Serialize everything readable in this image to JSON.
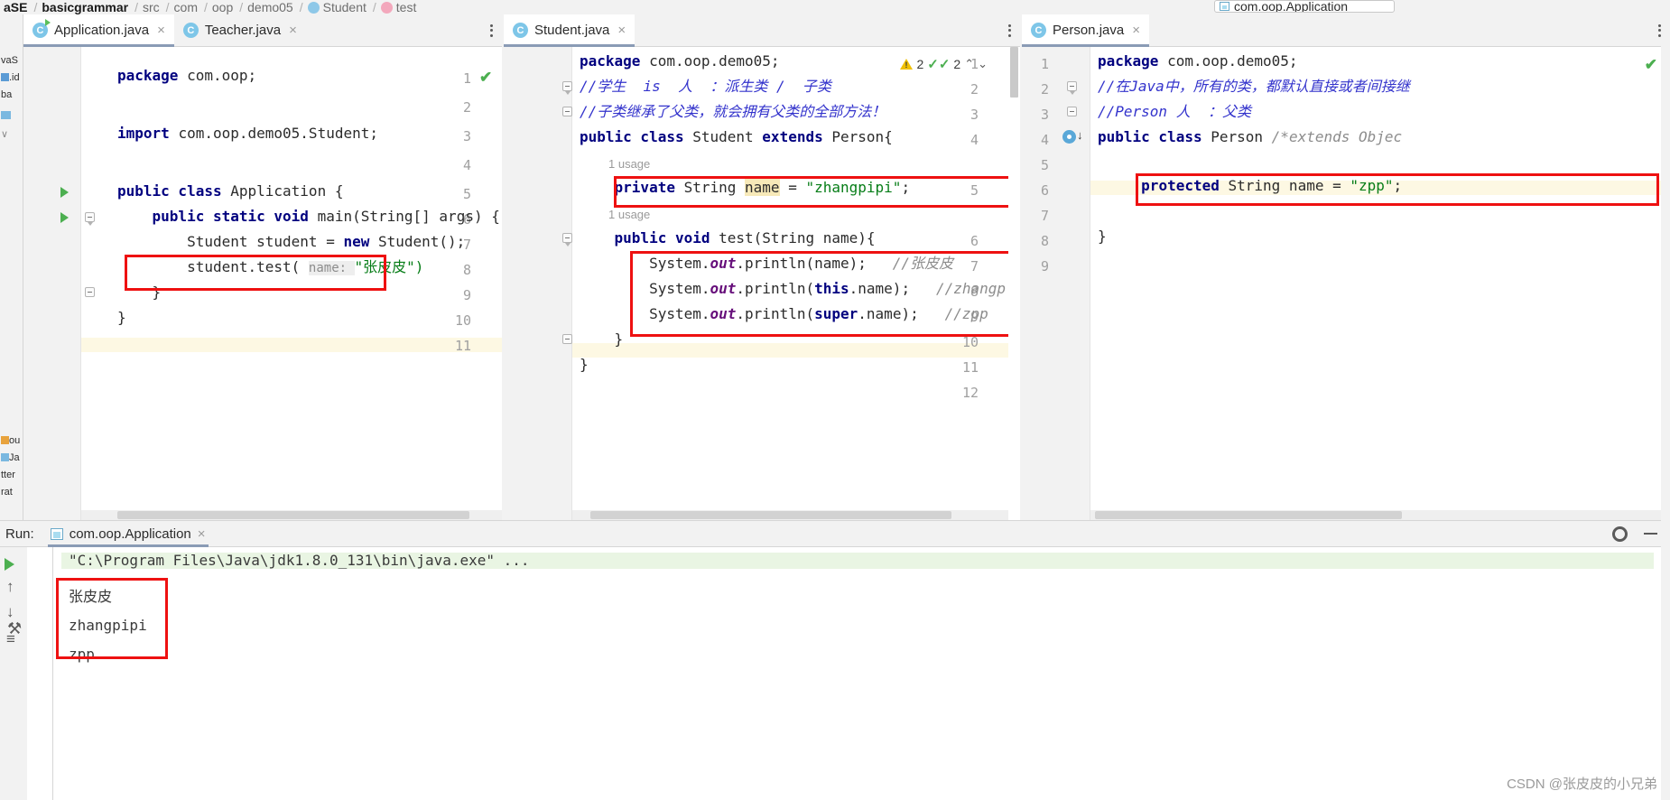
{
  "breadcrumb": {
    "items": [
      {
        "label": "aSE",
        "bold": true,
        "icon": ""
      },
      {
        "label": "basicgrammar",
        "bold": true,
        "icon": ""
      },
      {
        "label": "src",
        "bold": false,
        "icon": ""
      },
      {
        "label": "com",
        "bold": false,
        "icon": ""
      },
      {
        "label": "oop",
        "bold": false,
        "icon": ""
      },
      {
        "label": "demo05",
        "bold": false,
        "icon": ""
      },
      {
        "label": "Student",
        "bold": false,
        "icon": "class-dot-blue"
      },
      {
        "label": "test",
        "bold": false,
        "icon": "method-dot-pink"
      }
    ],
    "separator": "/"
  },
  "left_strip": {
    "items": [
      {
        "label": "vaS"
      },
      {
        "label": ".id"
      },
      {
        "label": "ba"
      },
      {
        "label": "ou"
      },
      {
        "label": "Ja"
      },
      {
        "label": "tter"
      },
      {
        "label": "rat"
      }
    ]
  },
  "run_config_top": {
    "name": "com.oop.Application"
  },
  "editor_panes": [
    {
      "id": "pane-left",
      "tabs": [
        {
          "label": "Application.java",
          "active": true,
          "icon": "java-class-run-icon",
          "close": "×"
        },
        {
          "label": "Teacher.java",
          "active": false,
          "icon": "java-class-icon",
          "close": "×"
        }
      ],
      "overflow_icon": "more-vertical-icon",
      "status_icon": "inspection-ok-check",
      "line_numbers": [
        "1",
        "2",
        "3",
        "4",
        "5",
        "6",
        "7",
        "8",
        "9",
        "10",
        "11"
      ],
      "code": [
        {
          "n": 1,
          "segments": [
            {
              "t": "package ",
              "c": "kw"
            },
            {
              "t": "com.oop;",
              "c": "plain"
            }
          ]
        },
        {
          "n": 2,
          "segments": []
        },
        {
          "n": 3,
          "segments": [
            {
              "t": "import ",
              "c": "kw"
            },
            {
              "t": "com.oop.demo05.Student;",
              "c": "plain"
            }
          ]
        },
        {
          "n": 4,
          "segments": []
        },
        {
          "n": 5,
          "segments": [
            {
              "t": "public class ",
              "c": "kw"
            },
            {
              "t": "Application {",
              "c": "plain"
            }
          ]
        },
        {
          "n": 6,
          "segments": [
            {
              "t": "    public static void ",
              "c": "kw"
            },
            {
              "t": "main(String[] args) {",
              "c": "plain"
            }
          ]
        },
        {
          "n": 7,
          "segments": [
            {
              "t": "        Student student = ",
              "c": "plain"
            },
            {
              "t": "new ",
              "c": "kw"
            },
            {
              "t": "Student();",
              "c": "plain"
            }
          ]
        },
        {
          "n": 8,
          "segments": [
            {
              "t": "        student.test( ",
              "c": "plain"
            },
            {
              "t": "name: ",
              "c": "hintp"
            },
            {
              "t": "\"张皮皮\")",
              "c": "str"
            }
          ]
        },
        {
          "n": 9,
          "segments": [
            {
              "t": "    }",
              "c": "plain"
            }
          ]
        },
        {
          "n": 10,
          "segments": [
            {
              "t": "}",
              "c": "plain"
            }
          ]
        },
        {
          "n": 11,
          "segments": []
        }
      ],
      "highlighted_line": 11
    },
    {
      "id": "pane-middle",
      "tabs": [
        {
          "label": "Student.java",
          "active": true,
          "icon": "java-class-icon",
          "close": "×"
        }
      ],
      "overflow_icon": "more-vertical-icon",
      "inspection": {
        "warning_count": "2",
        "check_count": "2",
        "up": "⌃",
        "down": "⌄"
      },
      "line_numbers": [
        "1",
        "2",
        "3",
        "4",
        "5",
        "6",
        "7",
        "8",
        "9",
        "10",
        "11",
        "12"
      ],
      "usage_hints": [
        "1 usage",
        "1 usage"
      ],
      "code": [
        {
          "n": 1,
          "segments": [
            {
              "t": "package ",
              "c": "kw"
            },
            {
              "t": "com.oop.demo05;",
              "c": "plain"
            }
          ]
        },
        {
          "n": 2,
          "segments": [
            {
              "t": "//学生  is  人  ：派生类 /  子类",
              "c": "cmt"
            }
          ]
        },
        {
          "n": 3,
          "segments": [
            {
              "t": "//子类继承了父类，就会拥有父类的全部方法！",
              "c": "cmt"
            }
          ]
        },
        {
          "n": 4,
          "segments": [
            {
              "t": "public class ",
              "c": "kw"
            },
            {
              "t": "Student ",
              "c": "plain"
            },
            {
              "t": "extends ",
              "c": "kw"
            },
            {
              "t": "Person{",
              "c": "plain"
            }
          ]
        },
        {
          "n": 5,
          "segments": [
            {
              "t": "    private ",
              "c": "kw"
            },
            {
              "t": "String ",
              "c": "plain"
            },
            {
              "t": "name",
              "c": "hl"
            },
            {
              "t": " = ",
              "c": "plain"
            },
            {
              "t": "\"zhangpipi\"",
              "c": "str"
            },
            {
              "t": ";",
              "c": "plain"
            }
          ]
        },
        {
          "n": 6,
          "segments": [
            {
              "t": "    public void ",
              "c": "kw"
            },
            {
              "t": "test(String name){",
              "c": "plain"
            }
          ]
        },
        {
          "n": 7,
          "segments": [
            {
              "t": "        System.",
              "c": "plain"
            },
            {
              "t": "out",
              "c": "fld"
            },
            {
              "t": ".println(name);   ",
              "c": "plain"
            },
            {
              "t": "//张皮皮",
              "c": "cmt-gray"
            }
          ]
        },
        {
          "n": 8,
          "segments": [
            {
              "t": "        System.",
              "c": "plain"
            },
            {
              "t": "out",
              "c": "fld"
            },
            {
              "t": ".println(",
              "c": "plain"
            },
            {
              "t": "this",
              "c": "kw"
            },
            {
              "t": ".name);   ",
              "c": "plain"
            },
            {
              "t": "//zhangp",
              "c": "cmt-gray"
            }
          ]
        },
        {
          "n": 9,
          "segments": [
            {
              "t": "        System.",
              "c": "plain"
            },
            {
              "t": "out",
              "c": "fld"
            },
            {
              "t": ".println(",
              "c": "plain"
            },
            {
              "t": "super",
              "c": "kw"
            },
            {
              "t": ".name);   ",
              "c": "plain"
            },
            {
              "t": "//zpp",
              "c": "cmt-gray"
            }
          ]
        },
        {
          "n": 10,
          "segments": [
            {
              "t": "    }",
              "c": "plain"
            }
          ]
        },
        {
          "n": 11,
          "segments": [
            {
              "t": "}",
              "c": "plain"
            }
          ]
        },
        {
          "n": 12,
          "segments": []
        }
      ],
      "highlighted_line": 9
    },
    {
      "id": "pane-right",
      "tabs": [
        {
          "label": "Person.java",
          "active": true,
          "icon": "java-class-icon",
          "close": "×"
        }
      ],
      "overflow_icon": "more-vertical-icon",
      "status_icon": "inspection-ok-check",
      "line_numbers": [
        "1",
        "2",
        "3",
        "4",
        "5",
        "6",
        "7",
        "8",
        "9"
      ],
      "code": [
        {
          "n": 1,
          "segments": [
            {
              "t": "package ",
              "c": "kw"
            },
            {
              "t": "com.oop.demo05;",
              "c": "plain"
            }
          ]
        },
        {
          "n": 2,
          "segments": [
            {
              "t": "//在Java中，所有的类，都默认直接或者间接继",
              "c": "cmt"
            }
          ]
        },
        {
          "n": 3,
          "segments": [
            {
              "t": "//Person 人  ：父类",
              "c": "cmt"
            }
          ]
        },
        {
          "n": 4,
          "segments": [
            {
              "t": "public class ",
              "c": "kw"
            },
            {
              "t": "Person ",
              "c": "plain"
            },
            {
              "t": "/*extends Objec",
              "c": "cmt-gray"
            }
          ]
        },
        {
          "n": 5,
          "segments": [
            {
              "t": "    protected ",
              "c": "kw"
            },
            {
              "t": "String name = ",
              "c": "plain"
            },
            {
              "t": "\"zpp\"",
              "c": "str"
            },
            {
              "t": ";",
              "c": "plain"
            }
          ]
        },
        {
          "n": 6,
          "segments": []
        },
        {
          "n": 7,
          "segments": []
        },
        {
          "n": 8,
          "segments": [
            {
              "t": "}",
              "c": "plain"
            }
          ]
        },
        {
          "n": 9,
          "segments": []
        }
      ],
      "highlighted_line": 5,
      "override_marker_line": 4
    }
  ],
  "run_panel": {
    "label": "Run:",
    "tab": {
      "label": "com.oop.Application",
      "close": "×",
      "icon": "run-config-icon"
    },
    "settings_icon": "gear-icon",
    "minimize_icon": "minimize-icon",
    "side_buttons": [
      "run-icon",
      "scroll-up-icon",
      "scroll-down-icon",
      "wrap-icon",
      "wrench-icon"
    ],
    "console_lines": [
      {
        "text": "\"C:\\Program Files\\Java\\jdk1.8.0_131\\bin\\java.exe\" ...",
        "highlight": true
      },
      {
        "text": "张皮皮",
        "highlight": false
      },
      {
        "text": "zhangpipi",
        "highlight": false
      },
      {
        "text": "zpp",
        "highlight": false
      }
    ]
  },
  "watermark": "CSDN @张皮皮的小兄弟",
  "colors": {
    "annotation_red": "#ee1111",
    "keyword_blue": "#00007f",
    "string_green": "#067d17",
    "comment_blue": "#3333cc",
    "highlight_yellow": "#fdf8e3",
    "tab_underline": "#8a9bb5"
  }
}
